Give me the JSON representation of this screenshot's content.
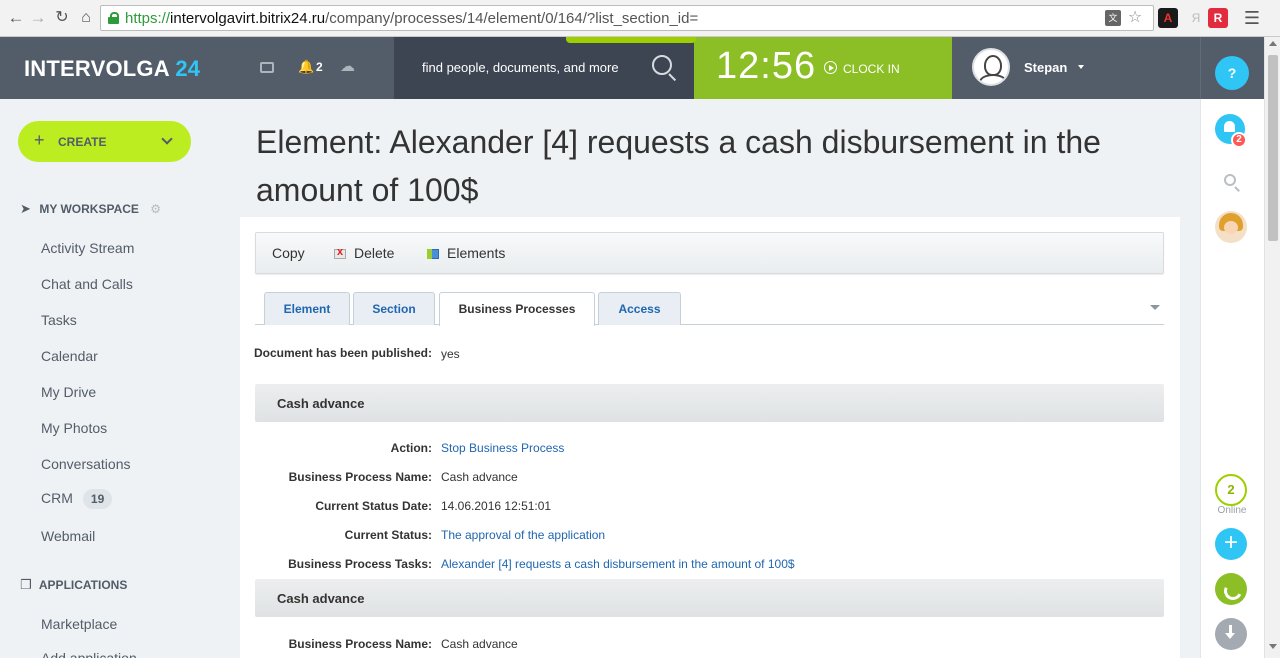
{
  "browser": {
    "url_scheme": "https://",
    "url_host": "intervolgavirt.bitrix24.ru",
    "url_path": "/company/processes/14/element/0/164/?list_section_id=",
    "translate_icon": "translate-icon",
    "ext_pdf": "A",
    "ext_ya": "Я",
    "ext_red": "R"
  },
  "header": {
    "logo_text": "INTERVOLGA",
    "logo_num": "24",
    "notif_count": "2",
    "search_placeholder": "find people, documents, and more",
    "clock_time": "12:56",
    "clock_label": "CLOCK IN",
    "user_name": "Stepan",
    "help_label": "?"
  },
  "sidebar": {
    "create_label": "CREATE",
    "workspace_label": "MY WORKSPACE",
    "items": [
      {
        "label": "Activity Stream"
      },
      {
        "label": "Chat and Calls"
      },
      {
        "label": "Tasks"
      },
      {
        "label": "Calendar"
      },
      {
        "label": "My Drive"
      },
      {
        "label": "My Photos"
      },
      {
        "label": "Conversations"
      },
      {
        "label": "CRM",
        "counter": "19"
      },
      {
        "label": "Webmail"
      }
    ],
    "apps_label": "APPLICATIONS",
    "app_items": [
      {
        "label": "Marketplace"
      },
      {
        "label": "Add application"
      }
    ]
  },
  "page": {
    "title": "Element: Alexander [4] requests a cash disbursement in the amount of 100$"
  },
  "toolbar": {
    "copy_label": "Copy",
    "delete_label": "Delete",
    "elements_label": "Elements"
  },
  "tabs": [
    {
      "label": "Element"
    },
    {
      "label": "Section"
    },
    {
      "label": "Business Processes"
    },
    {
      "label": "Access"
    }
  ],
  "details": {
    "published_label": "Document has been published:",
    "published_value": "yes",
    "section1_title": "Cash advance",
    "action_label": "Action:",
    "action_value": "Stop Business Process",
    "bp_name_label": "Business Process Name:",
    "bp_name_value": "Cash advance",
    "status_date_label": "Current Status Date:",
    "status_date_value": "14.06.2016 12:51:01",
    "status_label": "Current Status:",
    "status_value": "The approval of the application",
    "tasks_label": "Business Process Tasks:",
    "tasks_value": "Alexander [4] requests a cash disbursement in the amount of 100$",
    "section2_title": "Cash advance",
    "bp_name2_label": "Business Process Name:",
    "bp_name2_value": "Cash advance"
  },
  "right_rail": {
    "bell_count": "2",
    "online_count": "2",
    "online_label": "Online",
    "plus_label": "+"
  }
}
